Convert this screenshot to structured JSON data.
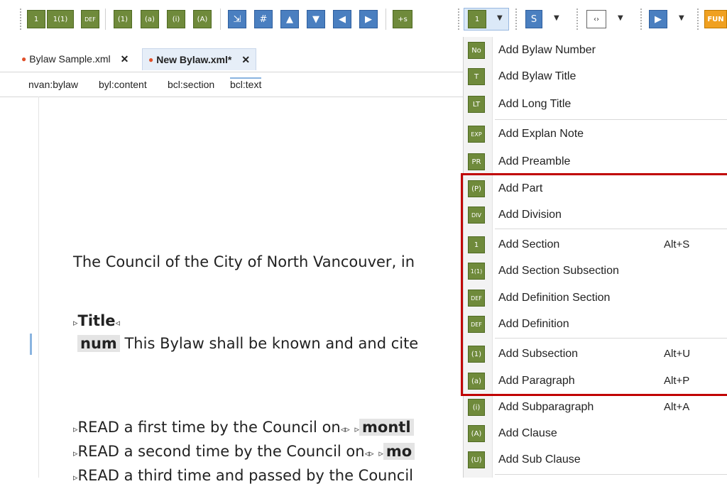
{
  "toolbar": {
    "left_buttons": [
      {
        "icon": "section-icon",
        "text": "1"
      },
      {
        "icon": "section-subsection-icon",
        "text": "1(1)"
      },
      {
        "icon": "definition-section-icon",
        "text": "DEF"
      },
      {
        "icon": "subsection-icon",
        "text": "(1)"
      },
      {
        "icon": "paragraph-icon",
        "text": "(a)"
      },
      {
        "icon": "subparagraph-icon",
        "text": "(i)"
      },
      {
        "icon": "clause-icon",
        "text": "(A)"
      },
      {
        "icon": "insert-icon",
        "text": "⇲"
      },
      {
        "icon": "hash-icon",
        "text": "#"
      },
      {
        "icon": "move-up-icon",
        "text": "▲"
      },
      {
        "icon": "move-down-icon",
        "text": "▼"
      },
      {
        "icon": "move-left-icon",
        "text": "◀"
      },
      {
        "icon": "move-right-icon",
        "text": "▶"
      },
      {
        "icon": "plus-s-icon",
        "text": "+s"
      }
    ],
    "dropdowns": [
      {
        "icon": "section-icon",
        "text": "1"
      },
      {
        "icon": "s-icon",
        "text": "S"
      },
      {
        "icon": "code-tag-icon",
        "text": "‹›"
      },
      {
        "icon": "play-icon",
        "text": "▶"
      }
    ],
    "fun_label": "FUN",
    "colors": {
      "green": "#6f8a3b",
      "blue": "#4a7fc0",
      "orange": "#f0a020"
    }
  },
  "tabs": [
    {
      "label": "Bylaw Sample.xml",
      "modified": true
    },
    {
      "label": "New Bylaw.xml*",
      "modified": true,
      "active": true
    }
  ],
  "breadcrumbs": [
    "nvan:bylaw",
    "byl:content",
    "bcl:section",
    "bcl:text"
  ],
  "editor": {
    "council_line": "The Council of the City of North Vancouver, in",
    "title_tag": "Title",
    "num_tag": "num",
    "bylaw_line": "This Bylaw shall be known and and cite",
    "read1": "READ a first time by the Council on",
    "read1_tag": "montl",
    "read2": "READ a second time by the Council on",
    "read2_tag": "mo",
    "read3": "READ a third time and passed by the Council"
  },
  "menu": {
    "items": [
      {
        "icon_text": "No",
        "label": "Add Bylaw Number",
        "shortcut": ""
      },
      {
        "icon_text": "T",
        "label": "Add Bylaw Title",
        "shortcut": ""
      },
      {
        "icon_text": "LT",
        "label": "Add Long Title",
        "shortcut": ""
      },
      {
        "icon_text": "EXP",
        "label": "Add Explan Note",
        "shortcut": ""
      },
      {
        "icon_text": "PR",
        "label": "Add Preamble",
        "shortcut": ""
      },
      {
        "icon_text": "(P)",
        "label": "Add Part",
        "shortcut": ""
      },
      {
        "icon_text": "DIV",
        "label": "Add Division",
        "shortcut": ""
      },
      {
        "icon_text": "1",
        "label": "Add Section",
        "shortcut": "Alt+S"
      },
      {
        "icon_text": "1(1)",
        "label": "Add Section Subsection",
        "shortcut": ""
      },
      {
        "icon_text": "DEF",
        "label": "Add Definition Section",
        "shortcut": ""
      },
      {
        "icon_text": "DEF",
        "label": "Add Definition",
        "shortcut": ""
      },
      {
        "icon_text": "(1)",
        "label": "Add Subsection",
        "shortcut": "Alt+U"
      },
      {
        "icon_text": "(a)",
        "label": "Add Paragraph",
        "shortcut": "Alt+P"
      },
      {
        "icon_text": "(i)",
        "label": "Add Subparagraph",
        "shortcut": "Alt+A"
      },
      {
        "icon_text": "(A)",
        "label": "Add Clause",
        "shortcut": ""
      },
      {
        "icon_text": "(U)",
        "label": "Add Sub Clause",
        "shortcut": ""
      }
    ],
    "highlight_color": "#c00000"
  }
}
